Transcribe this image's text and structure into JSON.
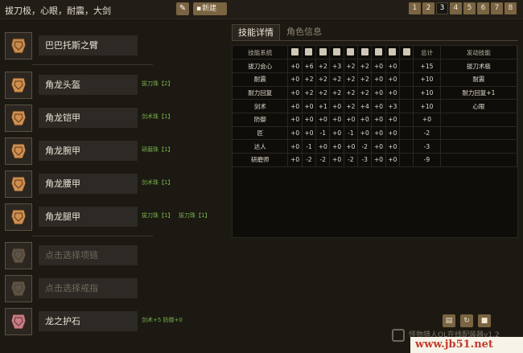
{
  "header": {
    "title": "拔刀极，心眼，耐震，大剑",
    "new_label": "新建",
    "pages": [
      "1",
      "2",
      "3",
      "4",
      "5",
      "6",
      "7",
      "8"
    ],
    "active_page": "3"
  },
  "equipment": [
    {
      "name": "巴巴托斯之臂",
      "decos": [],
      "icon": "weapon-arm-icon",
      "placeholder": false
    },
    {
      "name": "角龙头盔",
      "decos": [
        "拔刀珠【2】"
      ],
      "icon": "helmet-icon",
      "placeholder": false
    },
    {
      "name": "角龙铠甲",
      "decos": [
        "剑术珠【1】"
      ],
      "icon": "chest-armor-icon",
      "placeholder": false
    },
    {
      "name": "角龙腕甲",
      "decos": [
        "研磨珠【1】"
      ],
      "icon": "arm-armor-icon",
      "placeholder": false
    },
    {
      "name": "角龙腰甲",
      "decos": [
        "剑术珠【1】"
      ],
      "icon": "waist-armor-icon",
      "placeholder": false
    },
    {
      "name": "角龙腿甲",
      "decos": [
        "拔刀珠【1】",
        "拔刀珠【1】"
      ],
      "icon": "leg-armor-icon",
      "placeholder": false
    },
    {
      "name": "点击选择项链",
      "decos": [],
      "icon": "necklace-icon",
      "placeholder": true
    },
    {
      "name": "点击选择戒指",
      "decos": [],
      "icon": "ring-icon",
      "placeholder": true
    },
    {
      "name": "龙之护石",
      "decos": [
        "剑术+5 防御+0"
      ],
      "icon": "talisman-icon",
      "placeholder": false
    }
  ],
  "tabs": [
    "技能详情",
    "角色信息"
  ],
  "table": {
    "head_name": "技能系统",
    "head_total": "总计",
    "head_trigger": "发动技能",
    "col_icons": [
      "weapon-icon",
      "helmet-icon",
      "chest-icon",
      "arm-icon",
      "waist-icon",
      "leg-icon",
      "necklace-icon",
      "ring-icon",
      "talisman-icon"
    ],
    "rows": [
      {
        "name": "拔刀会心",
        "vals": [
          "+0",
          "+6",
          "+2",
          "+3",
          "+2",
          "+2",
          "+0",
          "+0"
        ],
        "total": "+15",
        "trigger": "拔刀术极"
      },
      {
        "name": "耐震",
        "vals": [
          "+0",
          "+2",
          "+2",
          "+2",
          "+2",
          "+2",
          "+0",
          "+0"
        ],
        "total": "+10",
        "trigger": "耐震"
      },
      {
        "name": "耐力回复",
        "vals": [
          "+0",
          "+2",
          "+2",
          "+2",
          "+2",
          "+2",
          "+0",
          "+0"
        ],
        "total": "+10",
        "trigger": "耐力回复+1"
      },
      {
        "name": "剑术",
        "vals": [
          "+0",
          "+0",
          "+1",
          "+0",
          "+2",
          "+4",
          "+0",
          "+3"
        ],
        "total": "+10",
        "trigger": "心眼"
      },
      {
        "name": "防御",
        "vals": [
          "+0",
          "+0",
          "+0",
          "+0",
          "+0",
          "+0",
          "+0",
          "+0"
        ],
        "total": "+0",
        "trigger": ""
      },
      {
        "name": "匠",
        "vals": [
          "+0",
          "+0",
          "-1",
          "+0",
          "-1",
          "+0",
          "+0",
          "+0"
        ],
        "total": "-2",
        "trigger": ""
      },
      {
        "name": "达人",
        "vals": [
          "+0",
          "-1",
          "+0",
          "+0",
          "+0",
          "-2",
          "+0",
          "+0"
        ],
        "total": "-3",
        "trigger": ""
      },
      {
        "name": "研磨师",
        "vals": [
          "+0",
          "-2",
          "-2",
          "+0",
          "-2",
          "-3",
          "+0",
          "+0"
        ],
        "total": "-9",
        "trigger": ""
      }
    ]
  },
  "footer": {
    "text": "怪物猎人OL在线配装器v1.2",
    "watermark": "www.jb51.net"
  },
  "colors": {
    "accent": "#7a6442",
    "deco_green": "#78b04a",
    "background": "#1c1913"
  }
}
